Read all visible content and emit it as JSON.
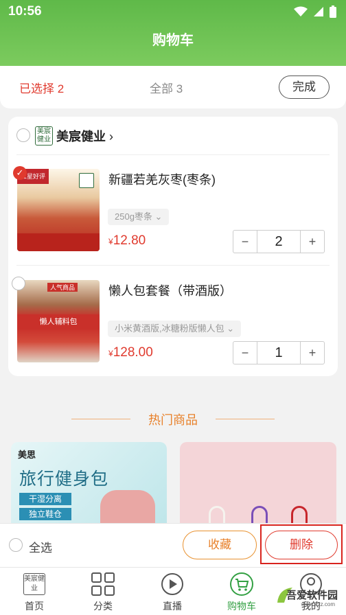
{
  "status_bar": {
    "time": "10:56"
  },
  "header": {
    "title": "购物车"
  },
  "selection": {
    "selected": "已选择 2",
    "total": "全部 3",
    "done_label": "完成"
  },
  "store": {
    "name": "美宸健业",
    "logo_text": "美宸健业",
    "items": [
      {
        "name": "新疆若羌灰枣(枣条)",
        "spec": "250g枣条",
        "currency": "¥",
        "price": "12.80",
        "qty": "2",
        "checked": true,
        "thumb_badge": "五星好评"
      },
      {
        "name": "懒人包套餐（带酒版）",
        "spec": "小米黄酒版,冰糖粉版懒人包",
        "currency": "¥",
        "price": "128.00",
        "qty": "1",
        "checked": false,
        "thumb_top": "人气商品",
        "thumb_band": "懒人辅料包"
      }
    ]
  },
  "hot": {
    "title": "热门商品"
  },
  "promo": {
    "brand": "美思",
    "title": "旅行健身包",
    "tags": [
      "干湿分离",
      "独立鞋仓"
    ]
  },
  "bottom": {
    "select_all": "全选",
    "favorite": "收藏",
    "delete": "删除"
  },
  "tabs": [
    {
      "label": "首页",
      "icon": "home-logo-icon",
      "icon_text": "美宸健业"
    },
    {
      "label": "分类",
      "icon": "grid-icon"
    },
    {
      "label": "直播",
      "icon": "play-icon"
    },
    {
      "label": "购物车",
      "icon": "cart-icon"
    },
    {
      "label": "我的",
      "icon": "user-icon"
    }
  ],
  "watermark": {
    "text": "吾爱软件园",
    "url": "www.52z.com"
  },
  "colors": {
    "accent_green": "#5fb949",
    "price_red": "#e03a2e",
    "orange": "#e8812b"
  }
}
